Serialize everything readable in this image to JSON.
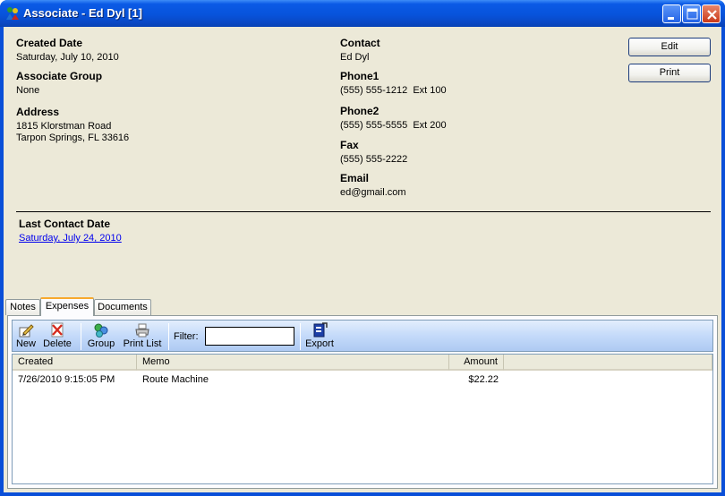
{
  "window": {
    "title": "Associate - Ed Dyl [1]"
  },
  "details": {
    "created_date_label": "Created Date",
    "created_date_value": "Saturday, July 10, 2010",
    "associate_group_label": "Associate Group",
    "associate_group_value": "None",
    "address_label": "Address",
    "address_line1": "1815 Klorstman Road",
    "address_line2": "Tarpon Springs, FL 33616",
    "contact_label": "Contact",
    "contact_value": "Ed Dyl",
    "phone1_label": "Phone1",
    "phone1_value": "(555) 555-1212  Ext 100",
    "phone2_label": "Phone2",
    "phone2_value": "(555) 555-5555  Ext 200",
    "fax_label": "Fax",
    "fax_value": "(555) 555-2222",
    "email_label": "Email",
    "email_value": "ed@gmail.com",
    "last_contact_label": "Last Contact Date",
    "last_contact_value": "Saturday, July 24, 2010"
  },
  "actions": {
    "edit_label": "Edit",
    "print_label": "Print"
  },
  "tabs": [
    {
      "label": "Notes"
    },
    {
      "label": "Expenses"
    },
    {
      "label": "Documents"
    }
  ],
  "toolbar": {
    "new_label": "New",
    "delete_label": "Delete",
    "group_label": "Group",
    "print_list_label": "Print List",
    "filter_label": "Filter:",
    "filter_value": "",
    "export_label": "Export"
  },
  "grid": {
    "columns": [
      "Created",
      "Memo",
      "Amount"
    ],
    "rows": [
      {
        "created": "7/26/2010 9:15:05 PM",
        "memo": "Route Machine",
        "amount": "$22.22"
      }
    ]
  },
  "colors": {
    "titlebar": "#0753db",
    "client_bg": "#ece9d8",
    "active_tab_accent": "#f7a92e",
    "link": "#0000ee"
  }
}
